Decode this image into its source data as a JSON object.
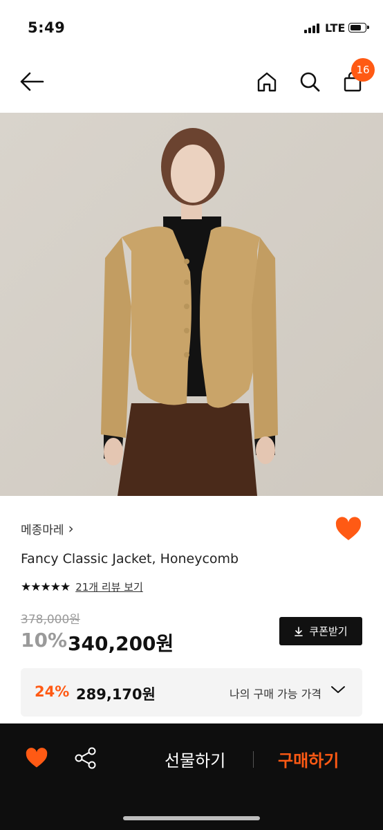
{
  "status_bar": {
    "time": "5:49",
    "carrier": "LTE"
  },
  "header": {
    "cart_count": "16"
  },
  "product": {
    "brand": "메종마레",
    "brand_chevron": "›",
    "name": "Fancy Classic Jacket, Honeycomb",
    "rating_stars": 5,
    "stars_text": "★★★★★",
    "review_link": "21개 리뷰 보기",
    "original_price": "378,000원",
    "discount_rate": "10%",
    "sale_price": "340,200원",
    "coupon_label": "쿠폰받기"
  },
  "my_price": {
    "rate": "24%",
    "price": "289,170원",
    "label": "나의 구매 가능 가격"
  },
  "bottom_bar": {
    "gift_label": "선물하기",
    "buy_label": "구매하기"
  },
  "colors": {
    "accent": "#ff5a14",
    "dark": "#0e0e0e",
    "image_bg": "#d7d2ca",
    "jacket": "#c9a469"
  },
  "icons": [
    "back-arrow-icon",
    "home-icon",
    "search-icon",
    "shopping-bag-icon",
    "heart-icon",
    "share-icon",
    "download-icon",
    "chevron-down-icon",
    "star-icon"
  ]
}
